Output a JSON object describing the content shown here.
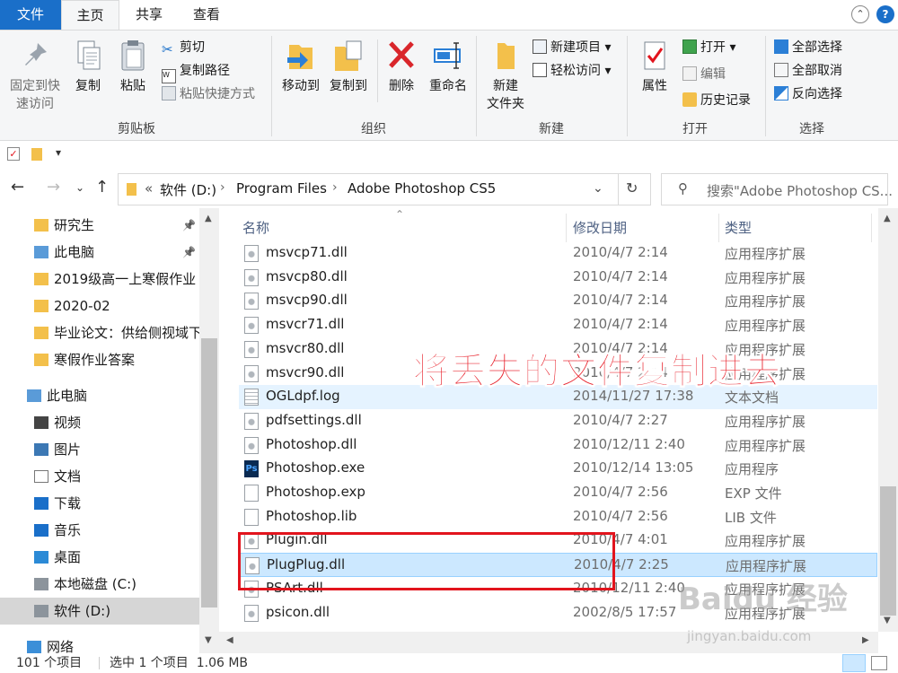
{
  "tabs": {
    "file": "文件",
    "home": "主页",
    "share": "共享",
    "view": "查看"
  },
  "ribbon": {
    "clipboard": {
      "pin_quick": [
        "固定到快",
        "速访问"
      ],
      "copy": "复制",
      "paste": "粘贴",
      "cut": "剪切",
      "copy_path": "复制路径",
      "paste_shortcut": "粘贴快捷方式",
      "label": "剪贴板"
    },
    "organize": {
      "move_to": "移动到",
      "copy_to": "复制到",
      "delete": "删除",
      "rename": "重命名",
      "label": "组织"
    },
    "new": {
      "new_folder": [
        "新建",
        "文件夹"
      ],
      "new_item": "新建项目",
      "easy_access": "轻松访问",
      "label": "新建"
    },
    "open": {
      "properties": "属性",
      "open": "打开",
      "edit": "编辑",
      "history": "历史记录",
      "label": "打开"
    },
    "select": {
      "select_all": "全部选择",
      "select_none": "全部取消",
      "invert": "反向选择",
      "label": "选择"
    }
  },
  "address": {
    "overflow": "«",
    "segments": [
      "软件 (D:)",
      "Program Files",
      "Adobe Photoshop CS5"
    ],
    "search_placeholder": "搜索\"Adobe Photoshop CS..."
  },
  "nav": {
    "items": [
      {
        "label": "研究生",
        "icon": "folder-icon",
        "pinned": true
      },
      {
        "label": "此电脑",
        "icon": "computer-icon",
        "pinned": true
      },
      {
        "label": "2019级高一上寒假作业",
        "icon": "folder-icon",
        "pinned": false
      },
      {
        "label": "2020-02",
        "icon": "folder-icon",
        "pinned": false
      },
      {
        "label": "毕业论文：供给侧视域下",
        "icon": "folder-icon",
        "pinned": false
      },
      {
        "label": "寒假作业答案",
        "icon": "folder-icon",
        "pinned": false
      },
      {
        "label": "此电脑",
        "icon": "computer-icon",
        "pinned": false
      },
      {
        "label": "视频",
        "icon": "video-icon",
        "pinned": false
      },
      {
        "label": "图片",
        "icon": "picture-icon",
        "pinned": false
      },
      {
        "label": "文档",
        "icon": "document-icon",
        "pinned": false
      },
      {
        "label": "下载",
        "icon": "download-icon",
        "pinned": false
      },
      {
        "label": "音乐",
        "icon": "music-icon",
        "pinned": false
      },
      {
        "label": "桌面",
        "icon": "desktop-icon",
        "pinned": false
      },
      {
        "label": "本地磁盘 (C:)",
        "icon": "drive-icon",
        "pinned": false
      },
      {
        "label": "软件 (D:)",
        "icon": "drive-icon",
        "pinned": false
      },
      {
        "label": "网络",
        "icon": "network-icon",
        "pinned": false
      }
    ]
  },
  "columns": {
    "name": "名称",
    "date": "修改日期",
    "type": "类型"
  },
  "files": [
    {
      "name": "msvcp71.dll",
      "date": "2010/4/7 2:14",
      "type": "应用程序扩展",
      "icon": "dll-icon"
    },
    {
      "name": "msvcp80.dll",
      "date": "2010/4/7 2:14",
      "type": "应用程序扩展",
      "icon": "dll-icon"
    },
    {
      "name": "msvcp90.dll",
      "date": "2010/4/7 2:14",
      "type": "应用程序扩展",
      "icon": "dll-icon"
    },
    {
      "name": "msvcr71.dll",
      "date": "2010/4/7 2:14",
      "type": "应用程序扩展",
      "icon": "dll-icon"
    },
    {
      "name": "msvcr80.dll",
      "date": "2010/4/7 2:14",
      "type": "应用程序扩展",
      "icon": "dll-icon"
    },
    {
      "name": "msvcr90.dll",
      "date": "2010/4/7 2:14",
      "type": "应用程序扩展",
      "icon": "dll-icon"
    },
    {
      "name": "OGLdpf.log",
      "date": "2014/11/27 17:38",
      "type": "文本文档",
      "icon": "text-file-icon"
    },
    {
      "name": "pdfsettings.dll",
      "date": "2010/4/7 2:27",
      "type": "应用程序扩展",
      "icon": "dll-icon"
    },
    {
      "name": "Photoshop.dll",
      "date": "2010/12/11 2:40",
      "type": "应用程序扩展",
      "icon": "dll-icon"
    },
    {
      "name": "Photoshop.exe",
      "date": "2010/12/14 13:05",
      "type": "应用程序",
      "icon": "photoshop-icon"
    },
    {
      "name": "Photoshop.exp",
      "date": "2010/4/7 2:56",
      "type": "EXP 文件",
      "icon": "blank-file-icon"
    },
    {
      "name": "Photoshop.lib",
      "date": "2010/4/7 2:56",
      "type": "LIB 文件",
      "icon": "blank-file-icon"
    },
    {
      "name": "Plugin.dll",
      "date": "2010/4/7 4:01",
      "type": "应用程序扩展",
      "icon": "dll-icon"
    },
    {
      "name": "PlugPlug.dll",
      "date": "2010/4/7 2:25",
      "type": "应用程序扩展",
      "icon": "dll-icon"
    },
    {
      "name": "PSArt.dll",
      "date": "2010/12/11 2:40",
      "type": "应用程序扩展",
      "icon": "dll-icon"
    },
    {
      "name": "psicon.dll",
      "date": "2002/8/5 17:57",
      "type": "应用程序扩展",
      "icon": "dll-icon"
    }
  ],
  "status": {
    "count": "101 个项目",
    "selected": "选中 1 个项目  1.06 MB"
  },
  "annotation": "将丢失的文件复制进去",
  "watermark": {
    "brand": "Baidu 经验",
    "url": "jingyan.baidu.com"
  },
  "colors": {
    "accent": "#1a6fc9",
    "annotation_red": "#e2141d",
    "selection": "#cce8ff",
    "hover": "#e5f3ff"
  }
}
